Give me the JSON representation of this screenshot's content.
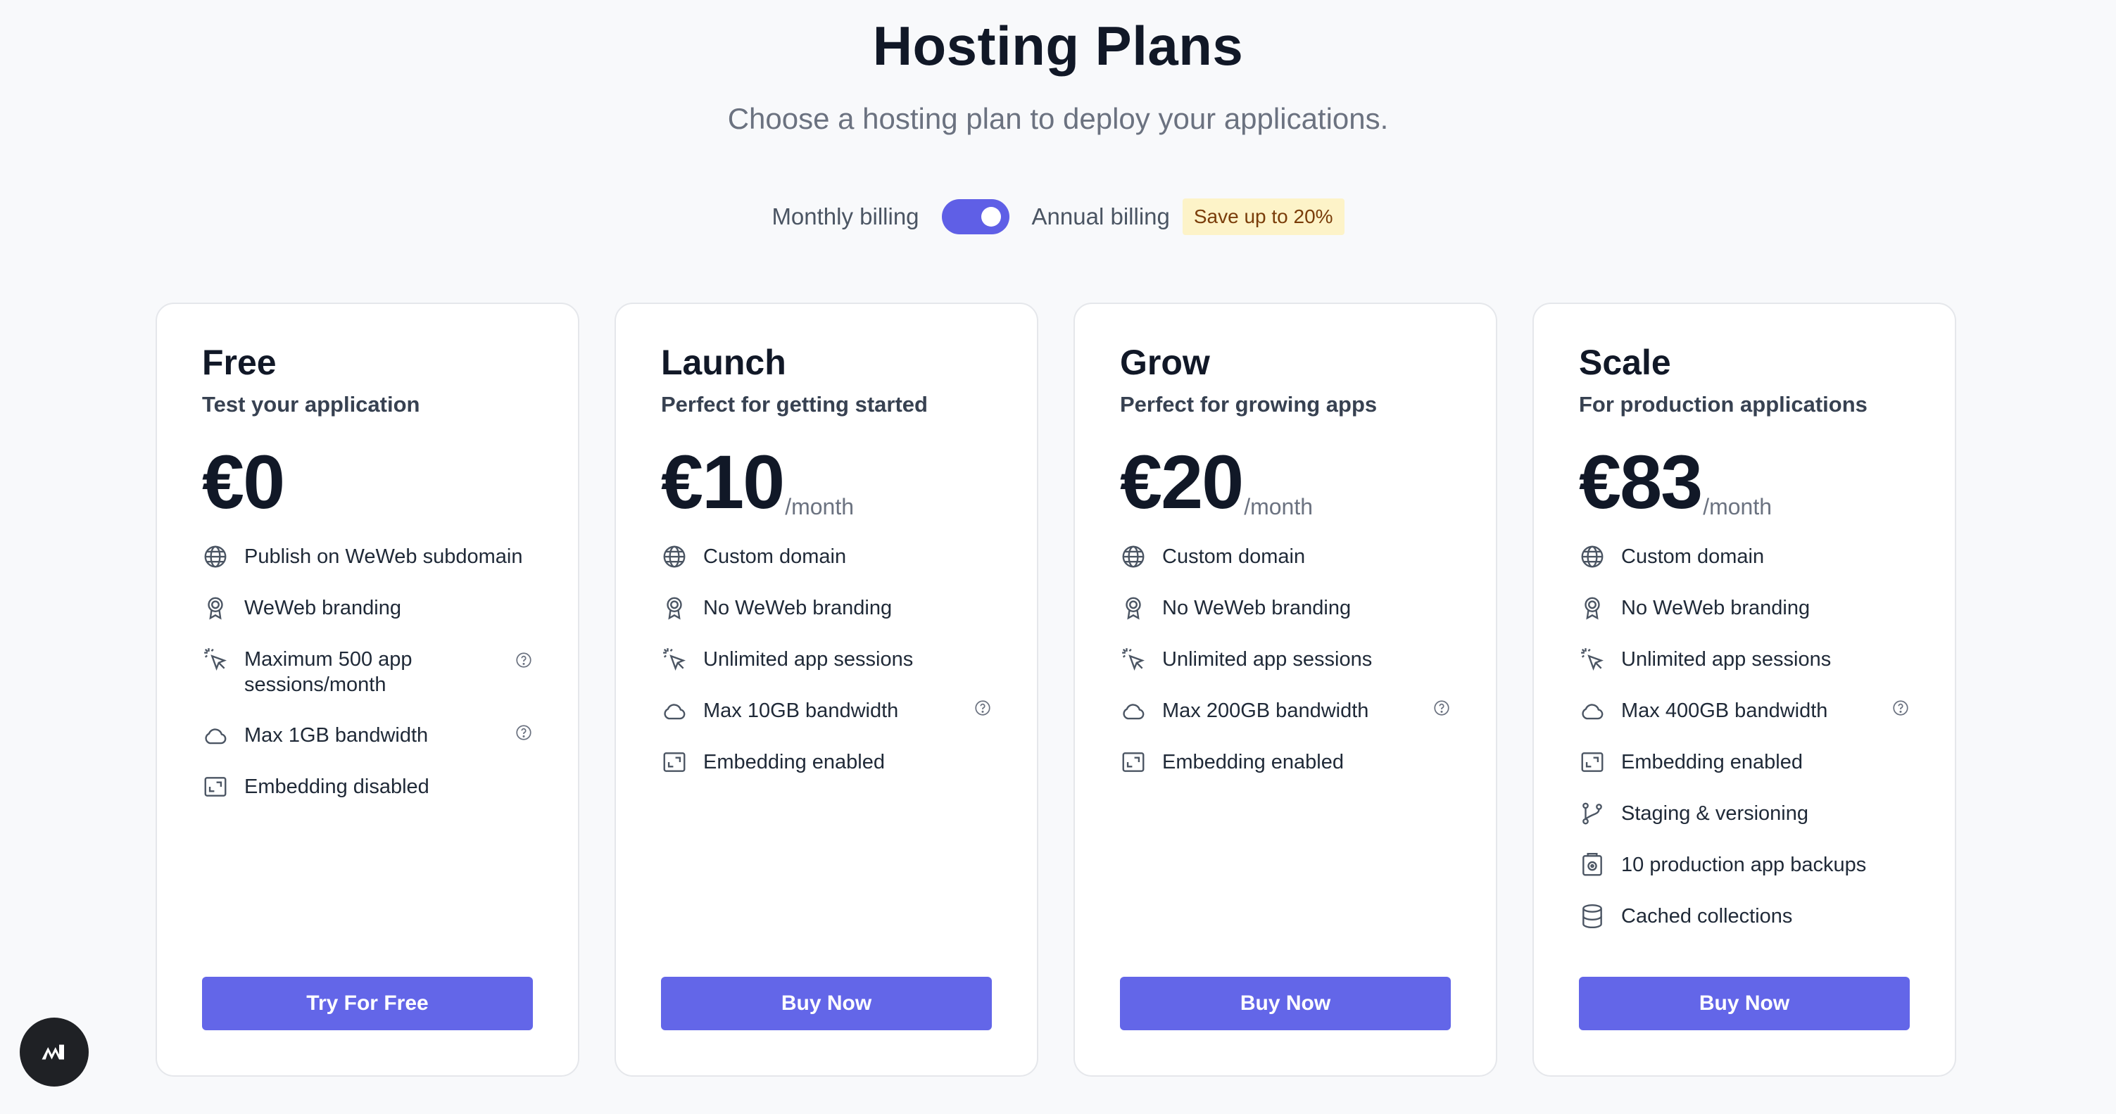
{
  "header": {
    "title": "Hosting Plans",
    "subtitle": "Choose a hosting plan to deploy your applications."
  },
  "billing": {
    "monthly_label": "Monthly billing",
    "annual_label": "Annual billing",
    "save_badge": "Save up to 20%",
    "annual_selected": true
  },
  "colors": {
    "accent": "#6366e8",
    "badge_bg": "#fdf3c8",
    "badge_text": "#7a3d0a"
  },
  "plans": [
    {
      "name": "Free",
      "tagline": "Test your application",
      "price": "€0",
      "period": "",
      "cta": "Try For Free",
      "features": [
        {
          "icon": "globe-icon",
          "text": "Publish on WeWeb subdomain"
        },
        {
          "icon": "badge-icon",
          "text": "WeWeb branding"
        },
        {
          "icon": "cursor-click-icon",
          "text": "Maximum 500 app sessions/month",
          "help": true
        },
        {
          "icon": "cloud-icon",
          "text": "Max 1GB bandwidth",
          "help": true
        },
        {
          "icon": "embed-icon",
          "text": "Embedding disabled"
        }
      ]
    },
    {
      "name": "Launch",
      "tagline": "Perfect for getting started",
      "price": "€10",
      "period": "/month",
      "cta": "Buy Now",
      "features": [
        {
          "icon": "globe-icon",
          "text": "Custom domain"
        },
        {
          "icon": "badge-icon",
          "text": "No WeWeb branding"
        },
        {
          "icon": "cursor-click-icon",
          "text": "Unlimited app sessions"
        },
        {
          "icon": "cloud-icon",
          "text": "Max 10GB bandwidth",
          "help": true
        },
        {
          "icon": "embed-icon",
          "text": "Embedding enabled"
        }
      ]
    },
    {
      "name": "Grow",
      "tagline": "Perfect for growing apps",
      "price": "€20",
      "period": "/month",
      "cta": "Buy Now",
      "features": [
        {
          "icon": "globe-icon",
          "text": "Custom domain"
        },
        {
          "icon": "badge-icon",
          "text": "No WeWeb branding"
        },
        {
          "icon": "cursor-click-icon",
          "text": "Unlimited app sessions"
        },
        {
          "icon": "cloud-icon",
          "text": "Max 200GB bandwidth",
          "help": true
        },
        {
          "icon": "embed-icon",
          "text": "Embedding enabled"
        }
      ]
    },
    {
      "name": "Scale",
      "tagline": "For production applications",
      "price": "€83",
      "period": "/month",
      "cta": "Buy Now",
      "features": [
        {
          "icon": "globe-icon",
          "text": "Custom domain"
        },
        {
          "icon": "badge-icon",
          "text": "No WeWeb branding"
        },
        {
          "icon": "cursor-click-icon",
          "text": "Unlimited app sessions"
        },
        {
          "icon": "cloud-icon",
          "text": "Max 400GB bandwidth",
          "help": true
        },
        {
          "icon": "embed-icon",
          "text": "Embedding enabled"
        },
        {
          "icon": "git-branch-icon",
          "text": "Staging & versioning"
        },
        {
          "icon": "backup-icon",
          "text": "10 production app backups"
        },
        {
          "icon": "database-icon",
          "text": "Cached collections"
        }
      ]
    }
  ],
  "fab": {
    "icon": "weweb-logo-icon"
  }
}
